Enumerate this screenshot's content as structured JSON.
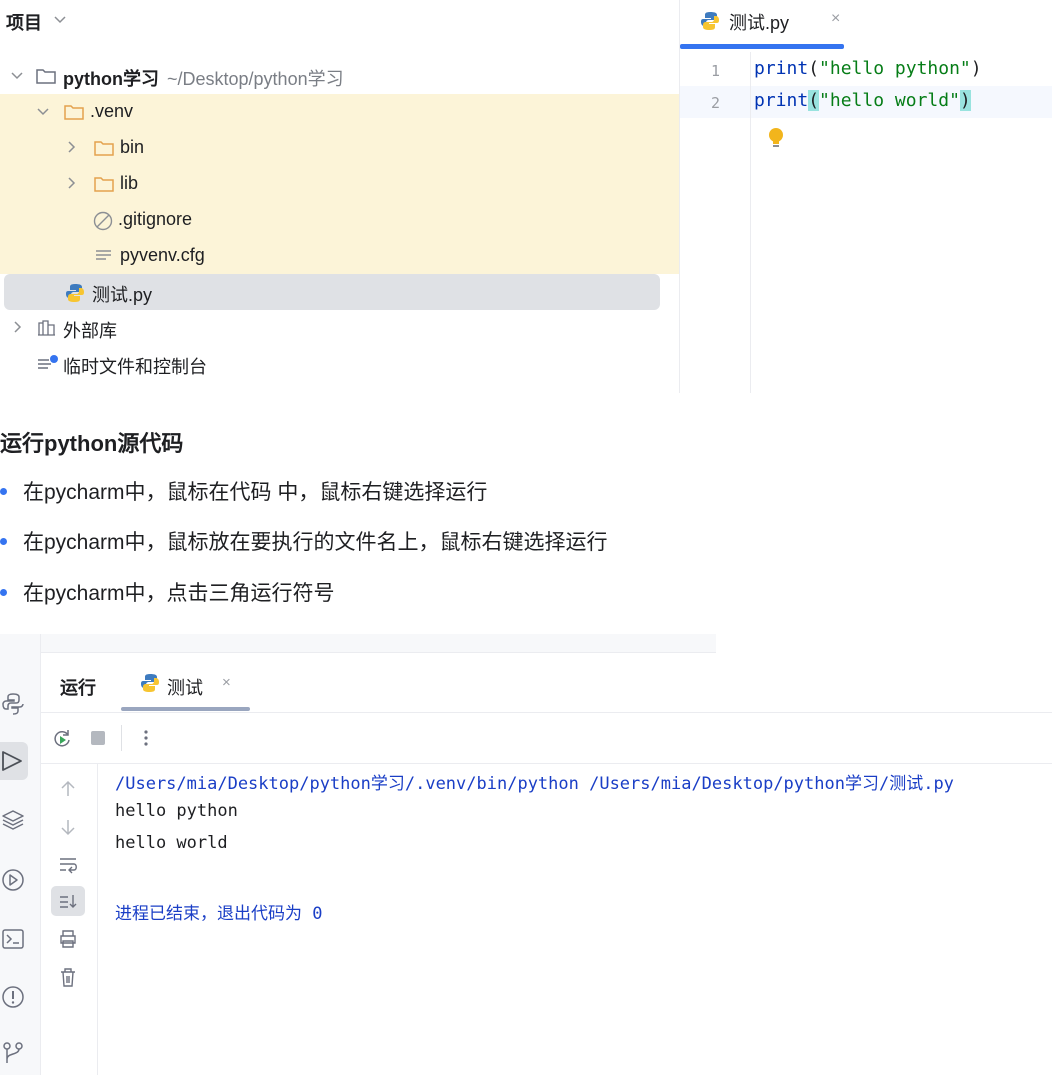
{
  "project": {
    "title": "项目",
    "root": {
      "name": "python学习",
      "path": "~/Desktop/python学习"
    },
    "items": [
      {
        "label": ".venv"
      },
      {
        "label": "bin"
      },
      {
        "label": "lib"
      },
      {
        "label": ".gitignore"
      },
      {
        "label": "pyvenv.cfg"
      },
      {
        "label": "测试.py"
      },
      {
        "label": "外部库"
      },
      {
        "label": "临时文件和控制台"
      }
    ]
  },
  "editor": {
    "tab": {
      "label": "测试.py",
      "close": "×"
    },
    "lines": [
      {
        "number": "1",
        "fn": "print",
        "open": "(",
        "str": "\"hello python\"",
        "close": ")"
      },
      {
        "number": "2",
        "fn": "print",
        "open": "(",
        "str": "\"hello world\"",
        "close": ")"
      }
    ]
  },
  "notes": {
    "title": "运行python源代码",
    "bullets": [
      "在pycharm中，鼠标在代码 中，鼠标右键选择运行",
      "在pycharm中，鼠标放在要执行的文件名上，鼠标右键选择运行",
      "在pycharm中，点击三角运行符号"
    ]
  },
  "run": {
    "label": "运行",
    "tab": {
      "label": "测试",
      "close": "×"
    },
    "console": {
      "command": "/Users/mia/Desktop/python学习/.venv/bin/python /Users/mia/Desktop/python学习/测试.py",
      "out1": "hello python",
      "out2": "hello world",
      "exit": "进程已结束，退出代码为 0"
    }
  },
  "colors": {
    "accent": "#3574f0",
    "highlight_bg": "#fcf4d8",
    "selection_bg": "#dfe1e5",
    "keyword": "#0033b3",
    "string": "#067d17",
    "bracket_match": "#99e3df",
    "console_path": "#1a3ec6"
  },
  "icons": {
    "folder": "folder-icon",
    "python_file": "python-file-icon",
    "gitignore": "ignored-file-icon",
    "text_file": "text-file-icon",
    "library": "library-icon",
    "scratches": "scratches-icon",
    "bulb": "lightbulb-icon"
  }
}
